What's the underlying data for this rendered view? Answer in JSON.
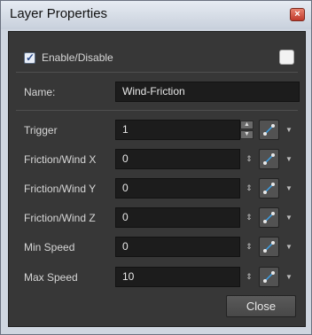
{
  "window": {
    "title": "Layer Properties",
    "close_glyph": "×"
  },
  "enable": {
    "label": "Enable/Disable",
    "checked": true,
    "color_swatch": "#f2f2f2"
  },
  "name": {
    "label": "Name:",
    "value": "Wind-Friction"
  },
  "rows": [
    {
      "label": "Trigger",
      "value": "1",
      "spinner": "arrows"
    },
    {
      "label": "Friction/Wind X",
      "value": "0",
      "spinner": "small"
    },
    {
      "label": "Friction/Wind Y",
      "value": "0",
      "spinner": "small"
    },
    {
      "label": "Friction/Wind Z",
      "value": "0",
      "spinner": "small"
    },
    {
      "label": "Min Speed",
      "value": "0",
      "spinner": "small"
    },
    {
      "label": "Max Speed",
      "value": "10",
      "spinner": "small"
    }
  ],
  "icons": {
    "function": "function-link-icon",
    "dropdown": "dropdown-arrow-icon",
    "spinner": "spinner-icon"
  },
  "buttons": {
    "close": "Close"
  },
  "colors": {
    "accent": "#3aa0e8",
    "panel_bg": "#373737",
    "field_bg": "#1c1c1c"
  }
}
